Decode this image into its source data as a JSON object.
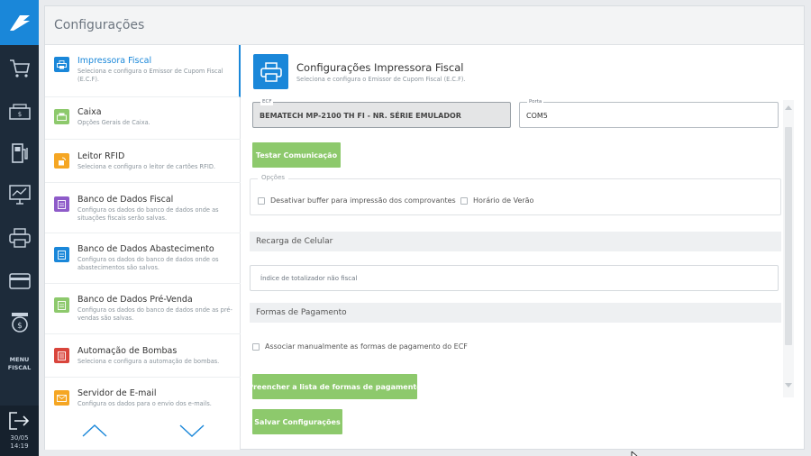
{
  "rail": {
    "items": [
      {
        "name": "cart-icon"
      },
      {
        "name": "cash-register-icon"
      },
      {
        "name": "fuel-pump-icon"
      },
      {
        "name": "monitor-chart-icon"
      },
      {
        "name": "printer-icon"
      },
      {
        "name": "card-icon"
      },
      {
        "name": "coin-icon"
      }
    ],
    "menu_line1": "MENU",
    "menu_line2": "FISCAL",
    "date": "30/05",
    "time": "14:19"
  },
  "header": {
    "title": "Configurações"
  },
  "nav": {
    "items": [
      {
        "label": "Impressora Fiscal",
        "desc": "Seleciona e configura o Emissor de Cupom Fiscal (E.C.F).",
        "color": "#1a87d9",
        "icon": "printer-icon",
        "active": true
      },
      {
        "label": "Caixa",
        "desc": "Opções Gerais de Caixa.",
        "color": "#8dc96c",
        "icon": "cash-register-icon"
      },
      {
        "label": "Leitor RFID",
        "desc": "Seleciona e configura o leitor de cartões RFID.",
        "color": "#f5a623",
        "icon": "rfid-icon"
      },
      {
        "label": "Banco de Dados Fiscal",
        "desc": "Configura os dados do banco de dados onde as situações fiscais serão salvas.",
        "color": "#8e5bc9",
        "icon": "database-icon"
      },
      {
        "label": "Banco de Dados Abastecimento",
        "desc": "Configura os dados do banco de dados onde os abastecimentos são salvos.",
        "color": "#1a87d9",
        "icon": "database-icon"
      },
      {
        "label": "Banco de Dados Pré-Venda",
        "desc": "Configura os dados do banco de dados onde as pré-vendas são salvas.",
        "color": "#8dc96c",
        "icon": "database-icon"
      },
      {
        "label": "Automação de Bombas",
        "desc": "Seleciona e configura a automação de bombas.",
        "color": "#d9453c",
        "icon": "fuel-pump-icon"
      },
      {
        "label": "Servidor de E-mail",
        "desc": "Configura os dados para o envio dos e-mails.",
        "color": "#f5a623",
        "icon": "email-icon"
      }
    ]
  },
  "content": {
    "title": "Configurações Impressora Fiscal",
    "subtitle": "Seleciona e configura o Emissor de Cupom Fiscal (E.C.F).",
    "ecf_legend": "ECF",
    "ecf_value": "BEMATECH MP-2100 TH FI - NR. SÉRIE EMULADOR",
    "porta_legend": "Porta",
    "porta_value": "COM5",
    "test_button": "Testar Comunicação",
    "options_legend": "Opções",
    "opt_buffer": "Desativar buffer para impressão dos comprovantes",
    "opt_horario": "Horário de Verão",
    "recarga_title": "Recarga de Celular",
    "totalizador_placeholder": "Índice de totalizador não fiscal",
    "formas_title": "Formas de Pagamento",
    "opt_associar": "Associar manualmente as formas de pagamento do ECF",
    "preencher_button": "Preencher a lista de formas de pagamento",
    "salvar_button": "Salvar Configurações"
  }
}
